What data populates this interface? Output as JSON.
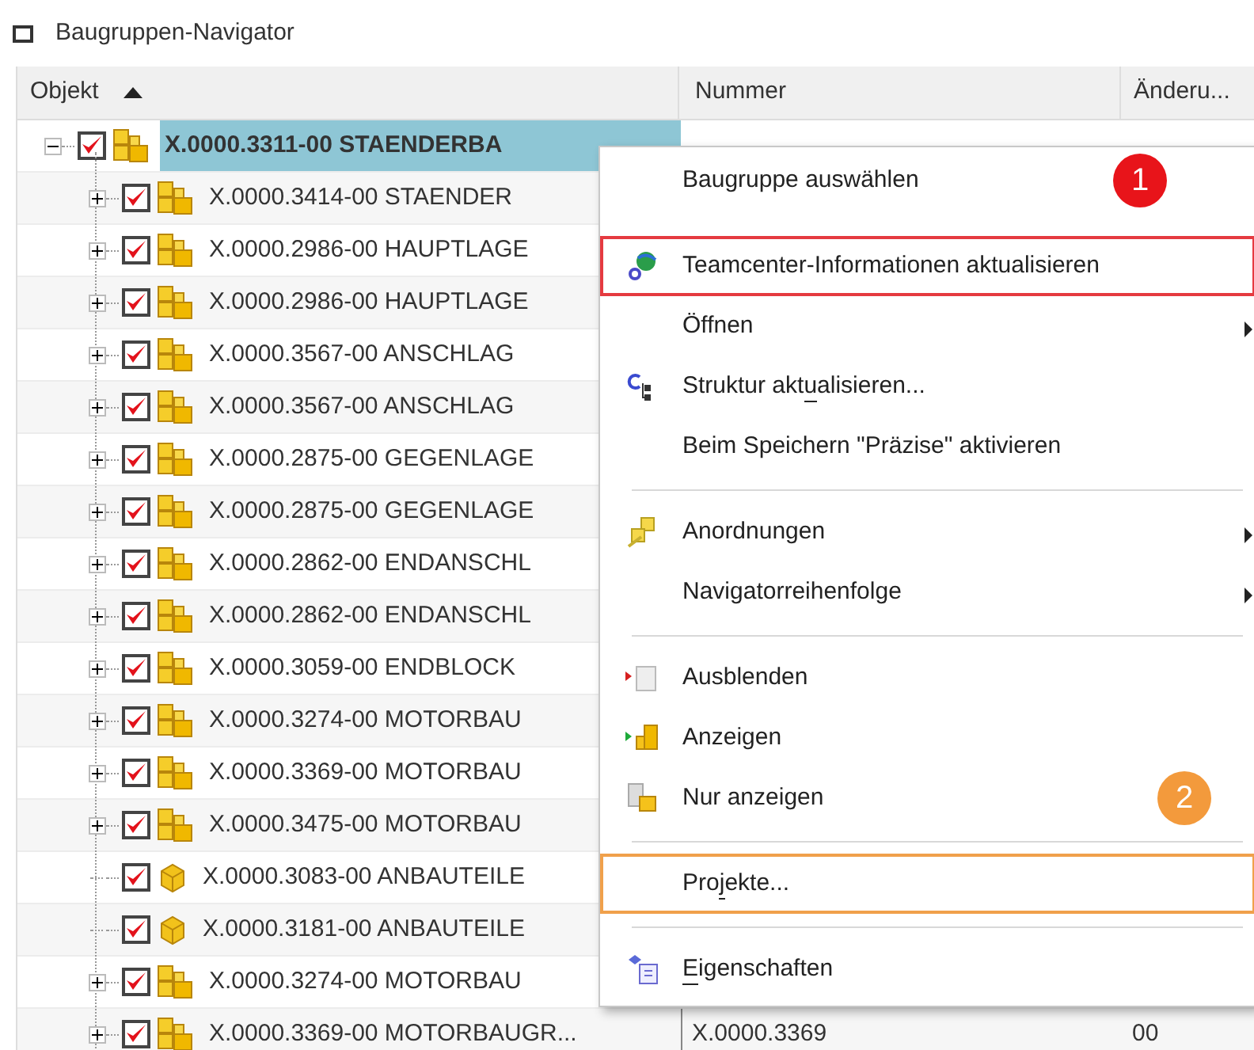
{
  "window": {
    "title": "Baugruppen-Navigator"
  },
  "table": {
    "columns": [
      {
        "label": "Objekt",
        "sorted": true
      },
      {
        "label": "Nummer",
        "sorted": false
      },
      {
        "label": "Änderu...",
        "sorted": false
      }
    ],
    "rows": [
      {
        "kind": "assembly",
        "expanded": true,
        "checked": true,
        "selected": true,
        "object": "X.0000.3311-00 STAENDERBA",
        "children": [
          {
            "kind": "assembly",
            "expanded": false,
            "checked": true,
            "selected": false,
            "object": "X.0000.3414-00 STAENDER"
          },
          {
            "kind": "assembly",
            "expanded": false,
            "checked": true,
            "selected": false,
            "object": "X.0000.2986-00 HAUPTLAGE"
          },
          {
            "kind": "assembly",
            "expanded": false,
            "checked": true,
            "selected": false,
            "object": "X.0000.2986-00 HAUPTLAGE"
          },
          {
            "kind": "assembly",
            "expanded": false,
            "checked": true,
            "selected": false,
            "object": "X.0000.3567-00 ANSCHLAG"
          },
          {
            "kind": "assembly",
            "expanded": false,
            "checked": true,
            "selected": false,
            "object": "X.0000.3567-00 ANSCHLAG"
          },
          {
            "kind": "assembly",
            "expanded": false,
            "checked": true,
            "selected": false,
            "object": "X.0000.2875-00 GEGENLAGE"
          },
          {
            "kind": "assembly",
            "expanded": false,
            "checked": true,
            "selected": false,
            "object": "X.0000.2875-00 GEGENLAGE"
          },
          {
            "kind": "assembly",
            "expanded": false,
            "checked": true,
            "selected": false,
            "object": "X.0000.2862-00 ENDANSCHL"
          },
          {
            "kind": "assembly",
            "expanded": false,
            "checked": true,
            "selected": false,
            "object": "X.0000.2862-00 ENDANSCHL"
          },
          {
            "kind": "assembly",
            "expanded": false,
            "checked": true,
            "selected": false,
            "object": "X.0000.3059-00 ENDBLOCK"
          },
          {
            "kind": "assembly",
            "expanded": false,
            "checked": true,
            "selected": false,
            "object": "X.0000.3274-00 MOTORBAU"
          },
          {
            "kind": "assembly",
            "expanded": false,
            "checked": true,
            "selected": false,
            "object": "X.0000.3369-00 MOTORBAU"
          },
          {
            "kind": "assembly",
            "expanded": false,
            "checked": true,
            "selected": false,
            "object": "X.0000.3475-00 MOTORBAU"
          },
          {
            "kind": "part",
            "checked": true,
            "selected": false,
            "object": "X.0000.3083-00 ANBAUTEILE"
          },
          {
            "kind": "part",
            "checked": true,
            "selected": false,
            "object": "X.0000.3181-00 ANBAUTEILE"
          },
          {
            "kind": "assembly",
            "expanded": false,
            "checked": true,
            "selected": false,
            "object": "X.0000.3274-00 MOTORBAU"
          },
          {
            "kind": "assembly",
            "expanded": false,
            "checked": true,
            "selected": false,
            "object": "X.0000.3369-00 MOTORBAUGR...",
            "number": "X.0000.3369",
            "revision": "00"
          }
        ]
      }
    ]
  },
  "context_menu": {
    "items": [
      {
        "kind": "item",
        "label_parts": [
          {
            "text": "Baugruppe auswählen",
            "underline": false
          }
        ],
        "submenu": false,
        "callout": {
          "text": "1",
          "color": "#e8141a"
        }
      },
      {
        "kind": "spacer"
      },
      {
        "kind": "item",
        "label_parts": [
          {
            "text": "Teamcenter-Informationen aktualisieren",
            "underline": false
          }
        ],
        "submenu": false,
        "color": "#e53a40"
      },
      {
        "kind": "item",
        "label_parts": [
          {
            "text": "Öffnen",
            "underline": false
          }
        ],
        "submenu": true
      },
      {
        "kind": "item",
        "label_parts": [
          {
            "text": "Struktur akt",
            "underline": false
          },
          {
            "text": "u",
            "underline": true
          },
          {
            "text": "alisieren...",
            "underline": false
          }
        ],
        "submenu": false
      },
      {
        "kind": "item",
        "label_parts": [
          {
            "text": "Beim Speichern \"Präzise\" aktivieren",
            "underline": false
          }
        ],
        "submenu": false
      },
      {
        "kind": "separator"
      },
      {
        "kind": "item",
        "label_parts": [
          {
            "text": "Anordnungen",
            "underline": false
          }
        ],
        "submenu": true
      },
      {
        "kind": "item",
        "label_parts": [
          {
            "text": "Navigatorreihenfolge",
            "underline": false
          }
        ],
        "submenu": true
      },
      {
        "kind": "separator"
      },
      {
        "kind": "item",
        "label_parts": [
          {
            "text": "Ausblenden",
            "underline": false
          }
        ],
        "submenu": false
      },
      {
        "kind": "item",
        "label_parts": [
          {
            "text": "Anzeigen",
            "underline": false
          }
        ],
        "submenu": false
      },
      {
        "kind": "item",
        "label_parts": [
          {
            "text": "Nur anzeigen",
            "underline": false
          }
        ],
        "submenu": false,
        "callout": {
          "text": "2",
          "color": "#f39a3c"
        }
      },
      {
        "kind": "separator"
      },
      {
        "kind": "item",
        "label_parts": [
          {
            "text": "Pro",
            "underline": false
          },
          {
            "text": "j",
            "underline": true
          },
          {
            "text": "ekte...",
            "underline": false
          }
        ],
        "submenu": false,
        "color": "#f0a04b"
      },
      {
        "kind": "separator"
      },
      {
        "kind": "item",
        "label_parts": [
          {
            "text": "E",
            "underline": true
          },
          {
            "text": "igenschaften",
            "underline": false
          }
        ],
        "submenu": false
      }
    ]
  }
}
